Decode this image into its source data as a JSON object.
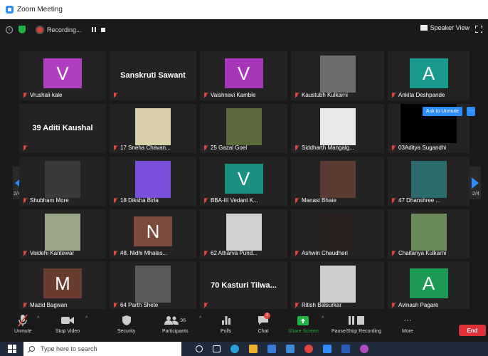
{
  "window": {
    "title": "Zoom Meeting"
  },
  "topbar": {
    "recording_label": "Recording...",
    "speaker_view_label": "Speaker View"
  },
  "pages": {
    "left": "2/4",
    "right": "2/4"
  },
  "ask_to_unmute": "Ask to Unmute",
  "ask_more": "···",
  "tiles": [
    {
      "name": "Vrushali kale",
      "type": "avatar",
      "initial": "V",
      "color": "#b03fbf"
    },
    {
      "name": "",
      "type": "text",
      "bigname": "Sanskruti Sawant"
    },
    {
      "name": "Vaishnavi Kamble",
      "type": "avatar",
      "initial": "V",
      "color": "#a637b8"
    },
    {
      "name": "Kaustubh Kulkarni",
      "type": "photo",
      "color": "#6b6d6e"
    },
    {
      "name": "Ankita Deshpande",
      "type": "avatar",
      "initial": "A",
      "color": "#1a9a8f"
    },
    {
      "name": "",
      "type": "text",
      "bigname": "39 Aditi Kaushal"
    },
    {
      "name": "17 Sneha Chavan...",
      "type": "photo",
      "color": "#d8d0a8"
    },
    {
      "name": "25 Gazal Goel",
      "type": "photo",
      "color": "#5d6a3c"
    },
    {
      "name": "Siddharth Mangalg...",
      "type": "photo",
      "color": "#e8e8e8"
    },
    {
      "name": "03Aditya Sugandhi",
      "type": "video",
      "color": "#000000"
    },
    {
      "name": "Shubham More",
      "type": "photo",
      "color": "#3a3a3a"
    },
    {
      "name": "18 Diksha Birla",
      "type": "photo",
      "color": "#7a4fd9"
    },
    {
      "name": "BBA-III Vedant K...",
      "type": "avatar",
      "initial": "V",
      "color": "#1a9080"
    },
    {
      "name": "Manasi Bhate",
      "type": "photo",
      "color": "#5a3a32"
    },
    {
      "name": "47 Dhanshree ...",
      "type": "photo",
      "color": "#2a6a6a"
    },
    {
      "name": "Vaidehi Kantewar",
      "type": "photo",
      "color": "#9ba688"
    },
    {
      "name": "48. Nidhi Mhalas...",
      "type": "avatar",
      "initial": "N",
      "color": "#7a4a3c"
    },
    {
      "name": "62 Atharva Pund...",
      "type": "photo",
      "color": "#d0d0d0"
    },
    {
      "name": "Ashwin Chaudhari",
      "type": "photo",
      "color": "#2a2220"
    },
    {
      "name": "Chaitanya Kulkarni",
      "type": "photo",
      "color": "#6b8a5a"
    },
    {
      "name": "Mazid Bagwan",
      "type": "avatar",
      "initial": "M",
      "color": "#6a3c30"
    },
    {
      "name": "64 Parth Shete",
      "type": "photo",
      "color": "#5a5a5a"
    },
    {
      "name": "",
      "type": "text",
      "bigname": "70 Kasturi Tilwa..."
    },
    {
      "name": "Ritish Balsurkar",
      "type": "photo",
      "color": "#cfcfcf"
    },
    {
      "name": "Avinash Pagare",
      "type": "avatar",
      "initial": "A",
      "color": "#1c9a55"
    }
  ],
  "toolbar": {
    "unmute": "Unmute",
    "stop_video": "Stop Video",
    "security": "Security",
    "participants": "Participants",
    "participants_count": "96",
    "polls": "Polls",
    "chat": "Chat",
    "chat_badge": "2",
    "share_screen": "Share Screen",
    "pause_recording": "Pause/Stop Recording",
    "more": "More",
    "more_dots": "···",
    "end": "End"
  },
  "taskbar": {
    "search_placeholder": "Type here to search"
  },
  "colors": {
    "accent": "#2d8cff",
    "end": "#e0303a",
    "share": "#1fb141",
    "muted": "#e8453c"
  }
}
